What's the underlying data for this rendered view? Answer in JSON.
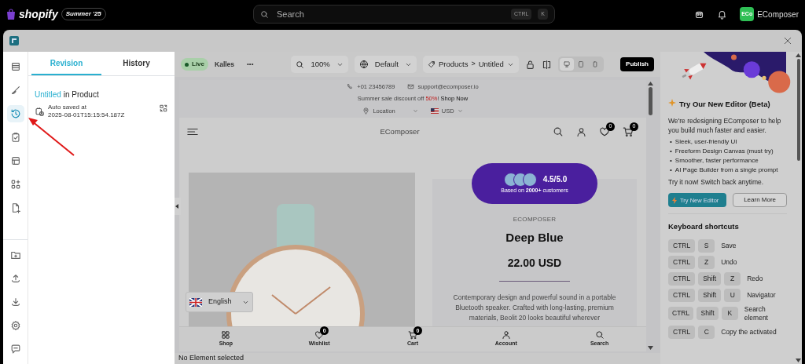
{
  "topbar": {
    "brand": "shopify",
    "edition": "Summer '25",
    "search": {
      "placeholder": "Search"
    },
    "shortcut": [
      "CTRL",
      "K"
    ],
    "account": {
      "initials": "ECo",
      "name": "EComposer"
    }
  },
  "sidebar": {
    "top_items": [
      {
        "selected": false
      },
      {
        "selected": false
      },
      {
        "selected": true
      },
      {
        "selected": false
      },
      {
        "selected": false
      },
      {
        "selected": false
      },
      {
        "selected": false
      }
    ],
    "bottom_items": [
      {
        "selected": false
      },
      {
        "selected": false
      },
      {
        "selected": false
      },
      {
        "selected": false
      },
      {
        "selected": false
      }
    ]
  },
  "revision_panel": {
    "tabs": [
      {
        "label": "Revision",
        "selected": true
      },
      {
        "label": "History",
        "selected": false
      }
    ],
    "entry": {
      "name": "Untitled",
      "context": "in Product",
      "saved_label": "Auto saved at",
      "timestamp": "2025-08-01T15:15:54.187Z"
    }
  },
  "toolbar": {
    "status": "Live",
    "theme": "Kalles",
    "more": "•••",
    "zoom": "100%",
    "language": "Default",
    "breadcrumb": [
      "Products",
      "Untitled"
    ],
    "breadcrumb_separator": ">",
    "devices": [
      {
        "selected": true
      },
      {
        "selected": false
      },
      {
        "selected": false
      }
    ],
    "publish": "Publish"
  },
  "preview": {
    "phone": "+01 23456789",
    "email": "support@ecomposer.io",
    "promo": {
      "text": "Summer sale discount off",
      "highlight": "50%",
      "end": "!",
      "link": "Shop Now"
    },
    "location": "Location",
    "currency": "USD",
    "store_name": "EComposer",
    "wishlist_count": "0",
    "cart_count": "0",
    "rating": "4.5/5.0",
    "rating_caption": "Based on **2000+** customers",
    "vendor": "ECOMPOSER",
    "title": "Deep Blue",
    "price": "22.00 USD",
    "description": "Contemporary design and powerful sound in a portable Bluetooth speaker. Crafted with long-lasting, premium materials, Beolit 20 looks beautiful wherever",
    "language": "English",
    "bottom_nav": [
      {
        "label": "Shop"
      },
      {
        "label": "Wishlist",
        "count": "0"
      },
      {
        "label": "Cart",
        "count": "0"
      },
      {
        "label": "Account"
      },
      {
        "label": "Search"
      }
    ]
  },
  "status_bar": "No Element selected",
  "right_panel": {
    "title": "Try Our New Editor (Beta)",
    "body": "We're redesigning EComposer to help you build much faster and easier.",
    "bullet_marker": "•",
    "bullets": [
      "Sleek, user-friendly UI",
      "Freeform Design Canvas (must try)",
      "Smoother, faster performance",
      "AI Page Builder from a single prompt"
    ],
    "cta": "Try it now! Switch back anytime.",
    "primary_button": "Try New Editor",
    "secondary_button": "Learn More",
    "shortcuts_title": "Keyboard shortcuts",
    "shortcuts": [
      {
        "keys": [
          "CTRL",
          "S"
        ],
        "label": "Save"
      },
      {
        "keys": [
          "CTRL",
          "Z"
        ],
        "label": "Undo"
      },
      {
        "keys": [
          "CTRL",
          "Shift",
          "Z"
        ],
        "label": "Redo"
      },
      {
        "keys": [
          "CTRL",
          "Shift",
          "U"
        ],
        "label": "Navigator"
      },
      {
        "keys": [
          "CTRL",
          "Shift",
          "K"
        ],
        "label": "Search element"
      },
      {
        "keys": [
          "CTRL",
          "C"
        ],
        "label": "Copy the activated"
      }
    ]
  }
}
